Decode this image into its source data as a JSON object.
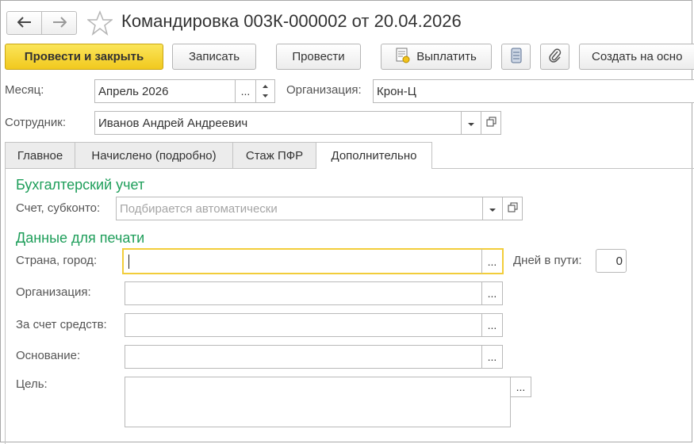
{
  "window": {
    "title": "Командировка 003К-000002 от 20.04.2026"
  },
  "toolbar": {
    "post_and_close": "Провести и закрыть",
    "save": "Записать",
    "post": "Провести",
    "pay": "Выплатить",
    "create_based_on": "Создать на осно"
  },
  "header_fields": {
    "month_label": "Месяц:",
    "month_value": "Апрель 2026",
    "org_label": "Организация:",
    "org_value": "Крон-Ц",
    "employee_label": "Сотрудник:",
    "employee_value": "Иванов Андрей Андреевич"
  },
  "tabs": [
    {
      "label": "Главное"
    },
    {
      "label": "Начислено (подробно)"
    },
    {
      "label": "Стаж ПФР"
    },
    {
      "label": "Дополнительно"
    }
  ],
  "accounting": {
    "section_title": "Бухгалтерский учет",
    "account_label": "Счет, субконто:",
    "account_placeholder": "Подбирается автоматически"
  },
  "print_data": {
    "section_title": "Данные для печати",
    "country_city_label": "Страна, город:",
    "country_city_value": "",
    "days_on_road_label": "Дней в пути:",
    "days_on_road_value": "0",
    "organization_label": "Организация:",
    "funding_label": "За счет средств:",
    "basis_label": "Основание:",
    "purpose_label": "Цель:"
  },
  "glyphs": {
    "ellipsis": "...",
    "dropdown": "▾",
    "back": "🡐",
    "forward": "🡒",
    "star": "☆"
  }
}
